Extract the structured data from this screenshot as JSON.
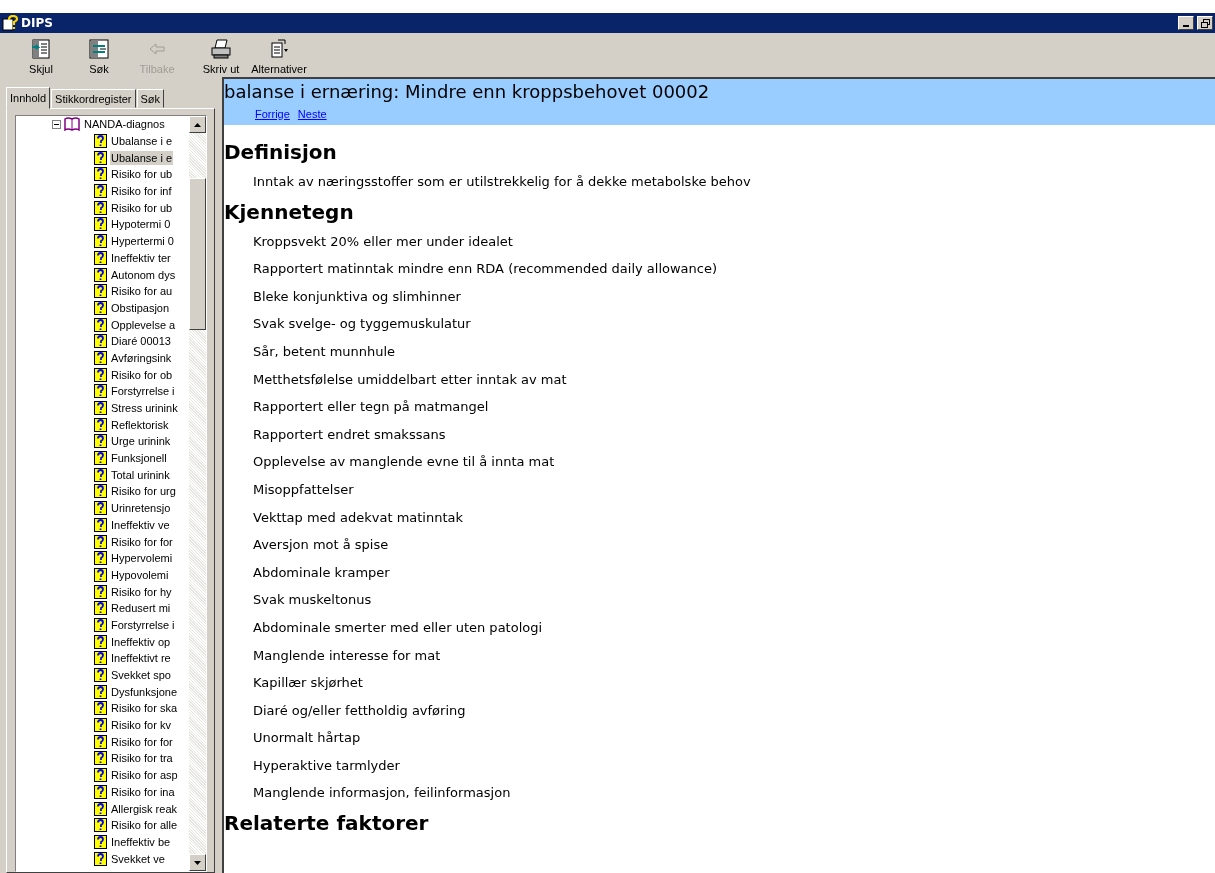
{
  "window": {
    "title": "DIPS"
  },
  "toolbar": [
    {
      "label": "Skjul",
      "kind": "hide",
      "disabled": false
    },
    {
      "label": "Søk",
      "kind": "search",
      "disabled": false
    },
    {
      "label": "Tilbake",
      "kind": "back",
      "disabled": true
    },
    {
      "label": "Skriv ut",
      "kind": "print",
      "disabled": false
    },
    {
      "label": "Alternativer",
      "kind": "options",
      "disabled": false
    }
  ],
  "tabs": [
    {
      "label": "Innhold",
      "selected": true
    },
    {
      "label": "Stikkordregister",
      "selected": false
    },
    {
      "label": "Søk",
      "selected": false
    }
  ],
  "tree": {
    "label": "NANDA-diagnos",
    "expanded": true,
    "children": [
      {
        "label": "Ubalanse i e",
        "selected": false
      },
      {
        "label": "Ubalanse i e",
        "selected": true
      },
      {
        "label": "Risiko for ub",
        "selected": false
      },
      {
        "label": "Risiko for inf",
        "selected": false
      },
      {
        "label": "Risiko for ub",
        "selected": false
      },
      {
        "label": "Hypotermi 0",
        "selected": false
      },
      {
        "label": "Hypertermi 0",
        "selected": false
      },
      {
        "label": "Ineffektiv ter",
        "selected": false
      },
      {
        "label": "Autonom dys",
        "selected": false
      },
      {
        "label": "Risiko for au",
        "selected": false
      },
      {
        "label": "Obstipasjon",
        "selected": false
      },
      {
        "label": "Opplevelse a",
        "selected": false
      },
      {
        "label": "Diaré 00013",
        "selected": false
      },
      {
        "label": "Avføringsink",
        "selected": false
      },
      {
        "label": "Risiko for ob",
        "selected": false
      },
      {
        "label": "Forstyrrelse i",
        "selected": false
      },
      {
        "label": "Stress urinink",
        "selected": false
      },
      {
        "label": "Reflektorisk",
        "selected": false
      },
      {
        "label": "Urge urinink",
        "selected": false
      },
      {
        "label": "Funksjonell",
        "selected": false
      },
      {
        "label": "Total urinink",
        "selected": false
      },
      {
        "label": "Risiko for urg",
        "selected": false
      },
      {
        "label": "Urinretensjo",
        "selected": false
      },
      {
        "label": "Ineffektiv ve",
        "selected": false
      },
      {
        "label": "Risiko for for",
        "selected": false
      },
      {
        "label": "Hypervolemi",
        "selected": false
      },
      {
        "label": "Hypovolemi",
        "selected": false
      },
      {
        "label": "Risiko for hy",
        "selected": false
      },
      {
        "label": "Redusert mi",
        "selected": false
      },
      {
        "label": "Forstyrrelse i",
        "selected": false
      },
      {
        "label": "Ineffektiv op",
        "selected": false
      },
      {
        "label": "Ineffektivt re",
        "selected": false
      },
      {
        "label": "Svekket spo",
        "selected": false
      },
      {
        "label": "Dysfunksjone",
        "selected": false
      },
      {
        "label": "Risiko for ska",
        "selected": false
      },
      {
        "label": "Risiko for kv",
        "selected": false
      },
      {
        "label": "Risiko for for",
        "selected": false
      },
      {
        "label": "Risiko for tra",
        "selected": false
      },
      {
        "label": "Risiko for asp",
        "selected": false
      },
      {
        "label": "Risiko for ina",
        "selected": false
      },
      {
        "label": "Allergisk reak",
        "selected": false
      },
      {
        "label": "Risiko for alle",
        "selected": false
      },
      {
        "label": "Ineffektiv be",
        "selected": false
      },
      {
        "label": "Svekket ve",
        "selected": false
      }
    ]
  },
  "topic": {
    "title": "balanse i ernæring: Mindre enn kroppsbehovet 00002",
    "links": [
      "Forrige",
      "Neste"
    ]
  },
  "sections": [
    {
      "heading": "Definisjon",
      "items": [
        "Inntak av næringsstoffer som er utilstrekkelig for å dekke metabolske behov"
      ]
    },
    {
      "heading": "Kjennetegn",
      "items": [
        "Kroppsvekt 20% eller mer under idealet",
        "Rapportert matinntak mindre enn RDA (recommended daily allowance)",
        "Bleke konjunktiva og slimhinner",
        "Svak svelge- og tyggemuskulatur",
        "Sår, betent munnhule",
        "Metthetsfølelse umiddelbart etter inntak av mat",
        "Rapportert eller tegn på matmangel",
        "Rapportert endret smakssans",
        "Opplevelse av manglende evne til å innta mat",
        "Misoppfattelser",
        "Vekttap med adekvat matinntak",
        "Aversjon mot å spise",
        "Abdominale kramper",
        "Svak muskeltonus",
        "Abdominale smerter med eller uten patologi",
        "Manglende interesse for mat",
        "Kapillær skjørhet",
        "Diaré og/eller fettholdig avføring",
        "Unormalt hårtap",
        "Hyperaktive tarmlyder",
        " Manglende informasjon, feilinformasjon"
      ]
    },
    {
      "heading": "Relaterte faktorer"
    }
  ]
}
